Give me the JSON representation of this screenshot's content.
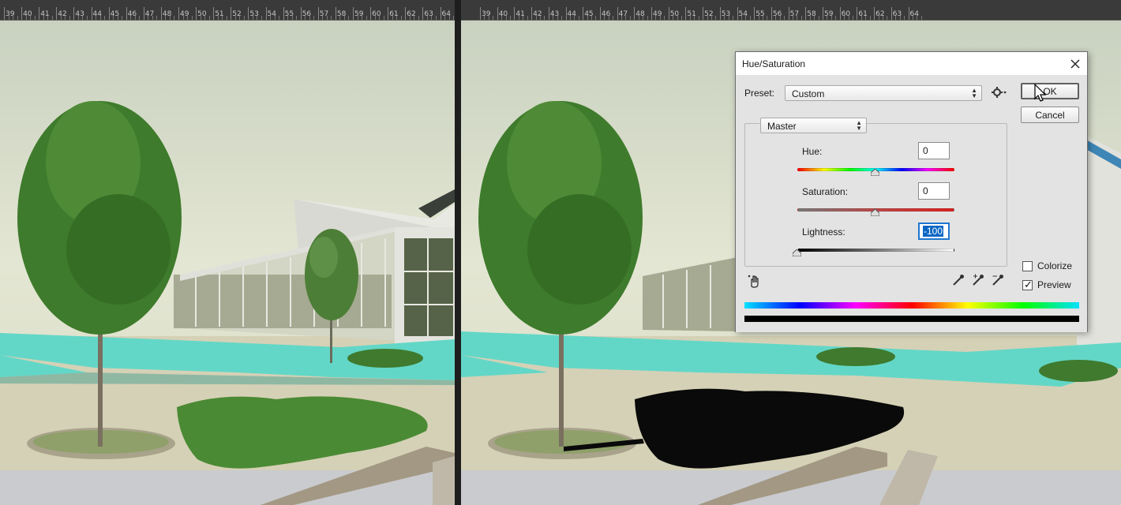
{
  "app": {
    "ruler_labels": [
      "39",
      "40",
      "41",
      "42",
      "43",
      "44",
      "45",
      "46",
      "47",
      "48",
      "49",
      "50",
      "51",
      "52",
      "53",
      "54",
      "55",
      "56",
      "57",
      "58",
      "59",
      "60",
      "61",
      "62",
      "63",
      "64"
    ]
  },
  "dialog": {
    "title": "Hue/Saturation",
    "preset_label": "Preset:",
    "preset_value": "Custom",
    "channel_value": "Master",
    "hue_label": "Hue:",
    "hue_value": "0",
    "saturation_label": "Saturation:",
    "saturation_value": "0",
    "lightness_label": "Lightness:",
    "lightness_value": "-100",
    "ok_label": "OK",
    "cancel_label": "Cancel",
    "colorize_label": "Colorize",
    "colorize_checked": false,
    "preview_label": "Preview",
    "preview_checked": true,
    "slider_levels": {
      "hue": 0,
      "saturation": 0,
      "lightness": -100
    }
  },
  "colors": {
    "canvas_bg": "#dfe2cf",
    "water": "#63d7c7",
    "tree_green": "#3e7b2c",
    "selected_shadow": "#0a0a0a",
    "dialog_bg": "#e3e3e3",
    "focus_blue": "#0a66c4"
  },
  "icons": [
    "close-icon",
    "gear-icon",
    "dropdown-arrows-icon",
    "hand-adjust-icon",
    "eyedropper-icon",
    "eyedropper-plus-icon",
    "eyedropper-minus-icon",
    "cursor-arrow-icon",
    "checkmark-icon"
  ]
}
